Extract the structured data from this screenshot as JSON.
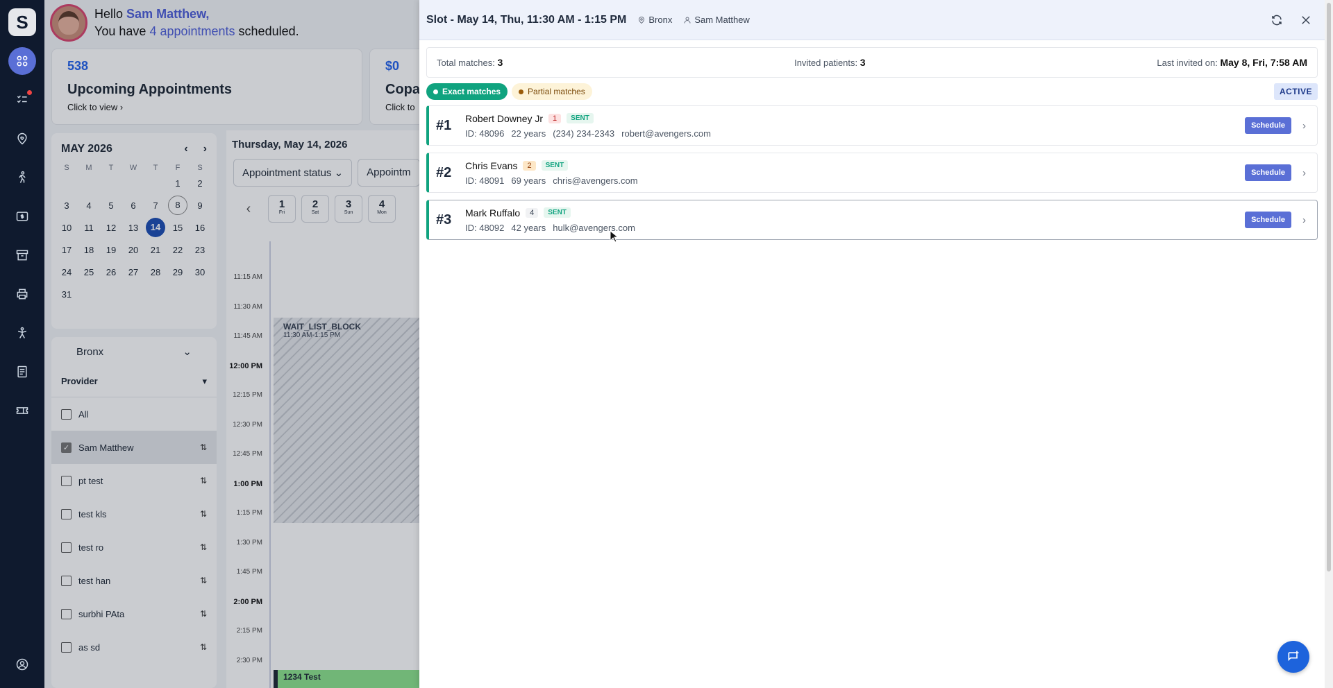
{
  "sidebar": {
    "logo": "S",
    "items": [
      {
        "icon": "dashboard-icon"
      },
      {
        "icon": "task-list-icon"
      },
      {
        "icon": "location-heart-icon"
      },
      {
        "icon": "walking-person-icon"
      },
      {
        "icon": "billing-icon"
      },
      {
        "icon": "archive-icon"
      },
      {
        "icon": "printer-icon"
      },
      {
        "icon": "exercise-icon"
      },
      {
        "icon": "document-icon"
      },
      {
        "icon": "ticket-icon"
      }
    ],
    "profile_icon": "user-circle-icon"
  },
  "greeting": {
    "hello": "Hello",
    "name": "Sam Matthew,",
    "line2_prefix": "You have",
    "appointments_count": "4 appointments",
    "line2_suffix": "scheduled."
  },
  "cards": [
    {
      "number": "538",
      "label": "Upcoming Appointments",
      "cta": "Click to view ›"
    },
    {
      "number": "$0",
      "label": "Copa",
      "cta": "Click to"
    }
  ],
  "calendar": {
    "month": "MAY 2026",
    "dow": [
      "S",
      "M",
      "T",
      "W",
      "T",
      "F",
      "S"
    ],
    "weeks": [
      [
        "",
        "",
        "",
        "",
        "",
        "1",
        "2"
      ],
      [
        "3",
        "4",
        "5",
        "6",
        "7",
        "8",
        "9"
      ],
      [
        "10",
        "11",
        "12",
        "13",
        "14",
        "15",
        "16"
      ],
      [
        "17",
        "18",
        "19",
        "20",
        "21",
        "22",
        "23"
      ],
      [
        "24",
        "25",
        "26",
        "27",
        "28",
        "29",
        "30"
      ],
      [
        "31",
        "",
        "",
        "",
        "",
        "",
        ""
      ]
    ],
    "selected": "14",
    "today_ring": "8"
  },
  "filters": {
    "location": "Bronx",
    "provider_label": "Provider",
    "providers": [
      {
        "name": "All",
        "checked": false
      },
      {
        "name": "Sam Matthew",
        "checked": true
      },
      {
        "name": "pt test",
        "checked": false
      },
      {
        "name": "test kls",
        "checked": false
      },
      {
        "name": "test ro",
        "checked": false
      },
      {
        "name": "test han",
        "checked": false
      },
      {
        "name": "surbhi PAta",
        "checked": false
      },
      {
        "name": "as sd",
        "checked": false
      }
    ]
  },
  "schedule": {
    "date_title": "Thursday, May 14, 2026",
    "filter1": "Appointment status",
    "filter2": "Appointm",
    "days": [
      {
        "num": "1",
        "dow": "Fri"
      },
      {
        "num": "2",
        "dow": "Sat"
      },
      {
        "num": "3",
        "dow": "Sun"
      },
      {
        "num": "4",
        "dow": "Mon"
      }
    ],
    "times": [
      "11:15 AM",
      "11:30 AM",
      "11:45 AM",
      "12:00 PM",
      "12:15 PM",
      "12:30 PM",
      "12:45 PM",
      "1:00 PM",
      "1:15 PM",
      "1:30 PM",
      "1:45 PM",
      "2:00 PM",
      "2:15 PM",
      "2:30 PM"
    ],
    "block_title": "WAIT_LIST_BLOCK",
    "block_time": "11:30 AM-1:15 PM",
    "appt_title": "1234 Test"
  },
  "drawer": {
    "title": "Slot - May 14, Thu, 11:30 AM - 1:15 PM",
    "location": "Bronx",
    "provider": "Sam Matthew",
    "summary": {
      "total_label": "Total matches:",
      "total_value": "3",
      "invited_label": "Invited patients:",
      "invited_value": "3",
      "last_label": "Last invited on:",
      "last_value": "May 8, Fri, 7:58 AM"
    },
    "tabs": {
      "exact": "Exact matches",
      "partial": "Partial matches"
    },
    "status": "ACTIVE",
    "schedule_label": "Schedule",
    "matches": [
      {
        "rank": "#1",
        "name": "Robert Downey Jr",
        "badge": "1",
        "sent": "SENT",
        "id": "ID: 48096",
        "age": "22 years",
        "phone": "(234) 234-2343",
        "email": "robert@avengers.com"
      },
      {
        "rank": "#2",
        "name": "Chris Evans",
        "badge": "2",
        "sent": "SENT",
        "id": "ID: 48091",
        "age": "69 years",
        "phone": "",
        "email": "chris@avengers.com"
      },
      {
        "rank": "#3",
        "name": "Mark Ruffalo",
        "badge": "4",
        "sent": "SENT",
        "id": "ID: 48092",
        "age": "42 years",
        "phone": "",
        "email": "hulk@avengers.com"
      }
    ]
  }
}
